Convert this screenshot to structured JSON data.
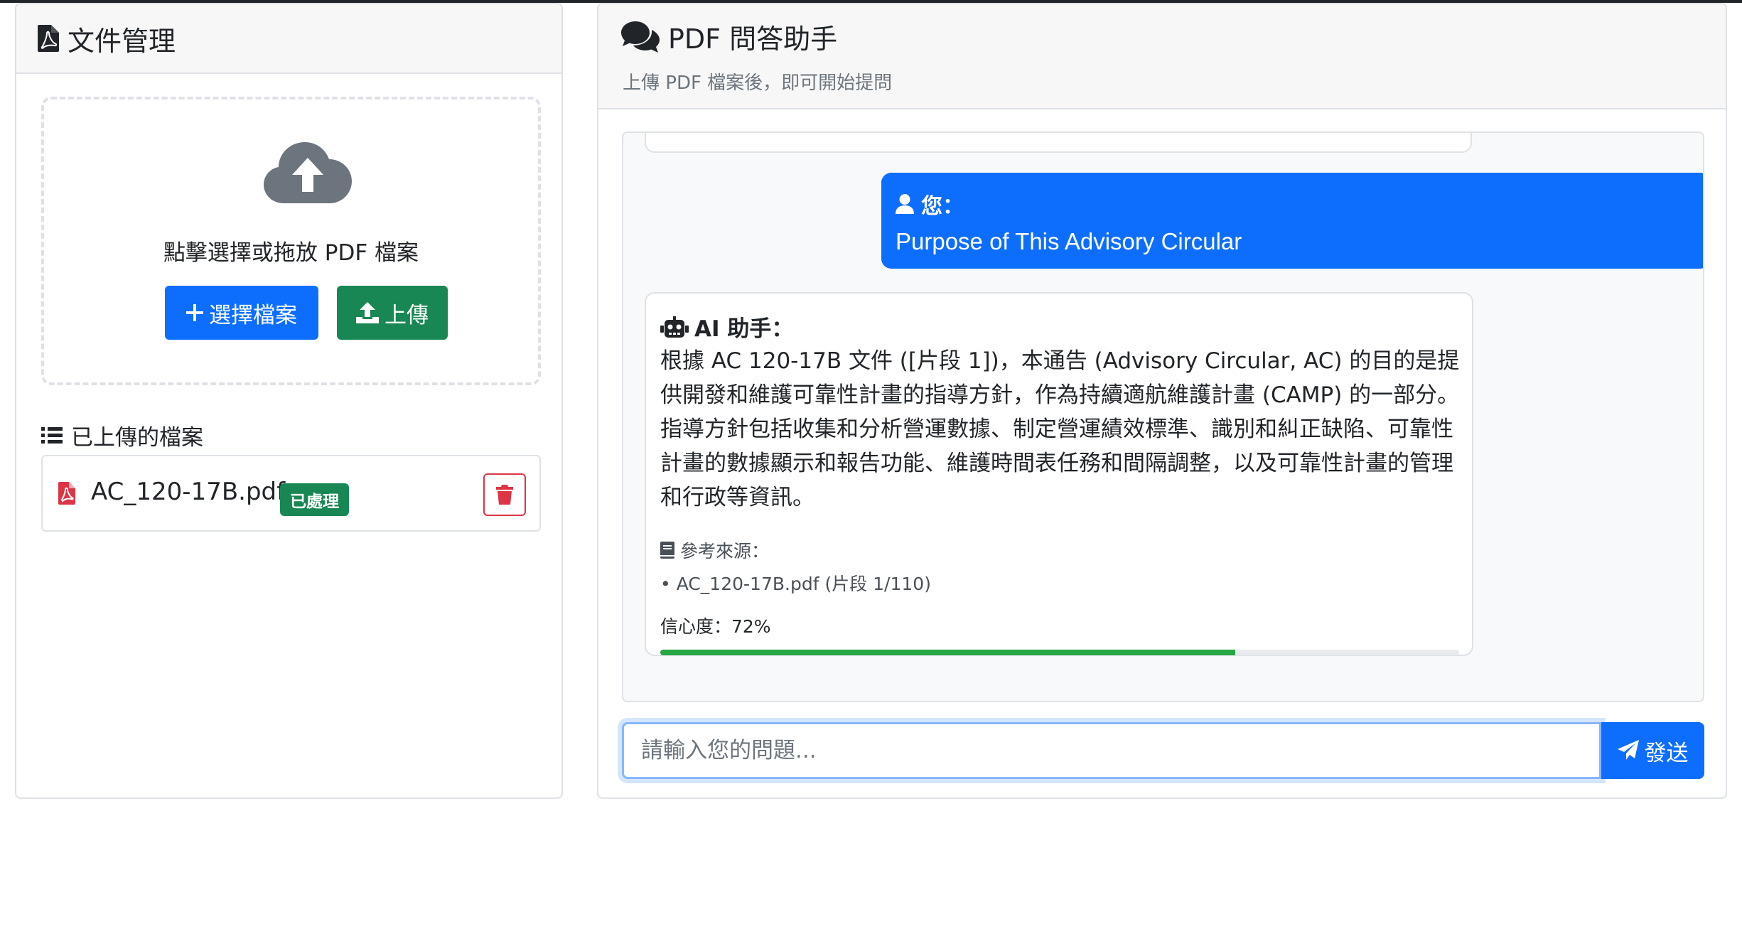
{
  "left_panel": {
    "title": "文件管理",
    "dropzone": {
      "text": "點擊選擇或拖放 PDF 檔案",
      "choose_label": "選擇檔案",
      "upload_label": "上傳"
    },
    "files_title": "已上傳的檔案",
    "files": [
      {
        "name": "AC_120-17B.pdf",
        "status": "已處理"
      }
    ]
  },
  "right_panel": {
    "title": "PDF 問答助手",
    "subtitle": "上傳 PDF 檔案後，即可開始提問",
    "messages": {
      "user": {
        "label": "您：",
        "text": "Purpose of This Advisory Circular"
      },
      "ai": {
        "label": "AI 助手：",
        "text": "根據 AC 120-17B 文件 ([片段 1])，本通告 (Advisory Circular, AC) 的目的是提供開發和維護可靠性計畫的指導方針，作為持續適航維護計畫 (CAMP) 的一部分。 指導方針包括收集和分析營運數據、制定營運績效標準、識別和糾正缺陷、可靠性計畫的數據顯示和報告功能、維護時間表任務和間隔調整，以及可靠性計畫的管理和行政等資訊。",
        "refs_title": "參考來源：",
        "ref_item": "• AC_120-17B.pdf (片段 1/110)",
        "confidence_label": "信心度：72%",
        "confidence": 0.72
      }
    },
    "input": {
      "placeholder": "請輸入您的問題...",
      "send_label": "發送"
    }
  },
  "colors": {
    "primary": "#0d6efd",
    "success": "#198754",
    "danger": "#dc3545",
    "progress": "#28a745"
  }
}
